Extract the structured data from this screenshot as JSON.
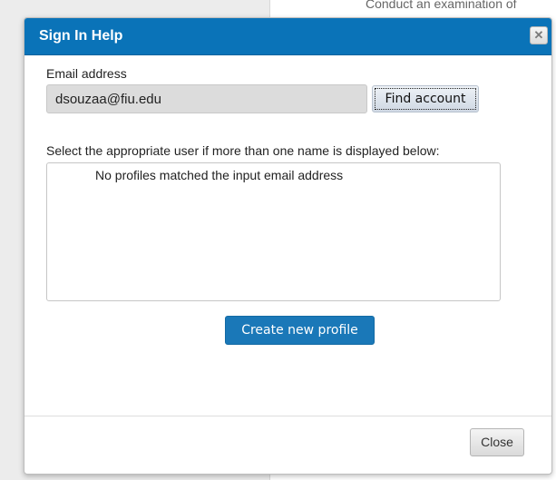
{
  "background": {
    "text": "Conduct an examination of"
  },
  "dialog": {
    "title": "Sign In Help",
    "close_icon": "close-icon",
    "email_label": "Email address",
    "email_value": "dsouzaa@fiu.edu",
    "find_button": "Find account",
    "select_label": "Select the appropriate user if more than one name is displayed below:",
    "list_message": "No profiles matched the input email address",
    "create_button": "Create new profile",
    "close_button": "Close"
  },
  "colors": {
    "titlebar": "#0a73b8",
    "primary_button": "#1a78b8"
  }
}
